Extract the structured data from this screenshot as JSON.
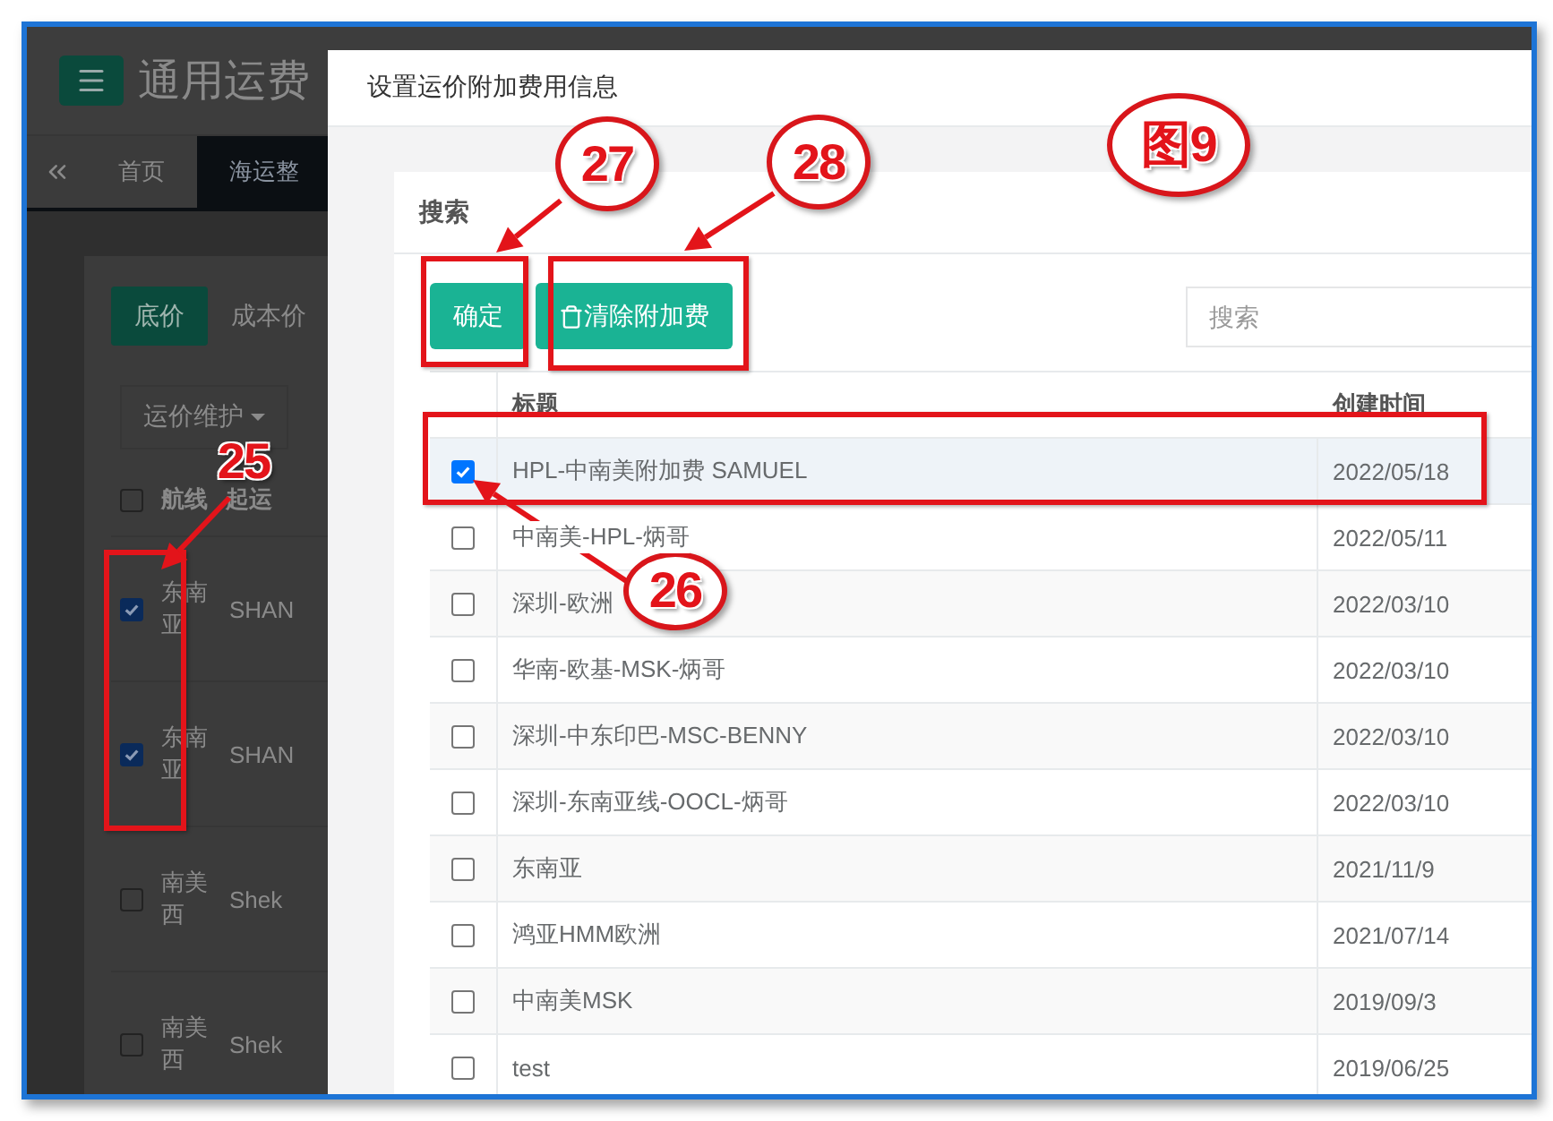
{
  "background_app": {
    "title": "通用运费",
    "tabs": [
      {
        "label": "首页",
        "selected": false
      },
      {
        "label": "海运整",
        "selected": true
      }
    ],
    "price_tabs": [
      {
        "label": "底价",
        "selected": true
      },
      {
        "label": "成本价",
        "selected": false
      }
    ],
    "dropdown": "运价维护",
    "select_all_checked": false,
    "columns": [
      "航线",
      "起运"
    ],
    "rows": [
      {
        "checked": true,
        "route": "东南亚",
        "port": "SHAN"
      },
      {
        "checked": true,
        "route": "东南亚",
        "port": "SHAN"
      },
      {
        "checked": false,
        "route": "南美西",
        "port": "Shek"
      },
      {
        "checked": false,
        "route": "南美西",
        "port": "Shek"
      }
    ]
  },
  "dialog": {
    "title": "设置运价附加费用信息",
    "panel_title": "搜索",
    "buttons": [
      {
        "label": "确定",
        "kind": "plain"
      },
      {
        "label": "清除附加费",
        "kind": "trash"
      }
    ],
    "search": {
      "placeholder": "搜索"
    },
    "columns": [
      "标题",
      "创建时间"
    ],
    "rows": [
      {
        "checked": true,
        "title": "HPL-中南美附加费 SAMUEL",
        "created": "2022/05/18"
      },
      {
        "checked": false,
        "title": "中南美-HPL-炳哥",
        "created": "2022/05/11"
      },
      {
        "checked": false,
        "title": "深圳-欧洲",
        "created": "2022/03/10"
      },
      {
        "checked": false,
        "title": "华南-欧基-MSK-炳哥",
        "created": "2022/03/10"
      },
      {
        "checked": false,
        "title": "深圳-中东印巴-MSC-BENNY",
        "created": "2022/03/10"
      },
      {
        "checked": false,
        "title": "深圳-东南亚线-OOCL-炳哥",
        "created": "2022/03/10"
      },
      {
        "checked": false,
        "title": "东南亚",
        "created": "2021/11/9"
      },
      {
        "checked": false,
        "title": "鸿亚HMM欧洲",
        "created": "2021/07/14"
      },
      {
        "checked": false,
        "title": "中南美MSK",
        "created": "2019/09/3"
      },
      {
        "checked": false,
        "title": "test",
        "created": "2019/06/25"
      }
    ]
  },
  "annotations": [
    {
      "label": "27",
      "kind": "circle"
    },
    {
      "label": "28",
      "kind": "circle"
    },
    {
      "label": "图9",
      "kind": "circle"
    },
    {
      "label": "25",
      "kind": "plain"
    },
    {
      "label": "26",
      "kind": "circle"
    }
  ]
}
